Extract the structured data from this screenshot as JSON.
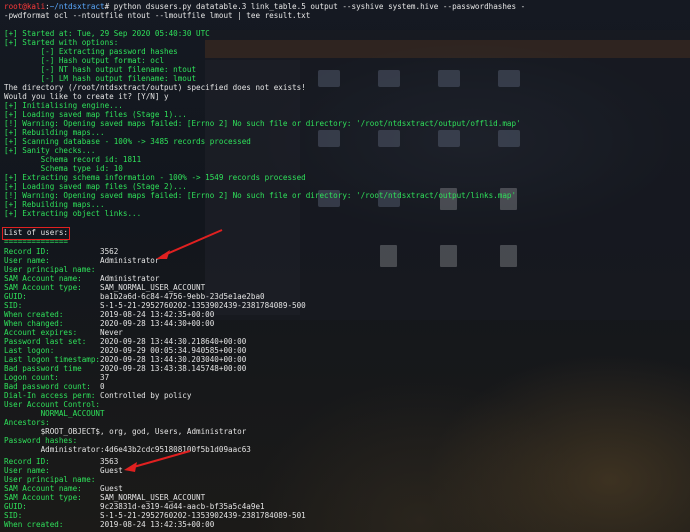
{
  "prompt": {
    "user": "root@kali",
    "path": "~/ntdsxtract",
    "symbol": "#",
    "command_1": " python dsusers.py datatable.3 link_table.5 output --syshive system.hive --passwordhashes -",
    "command_2": "-pwdformat ocl --ntoutfile ntout --lmoutfile lmout | tee result.txt"
  },
  "startup": [
    "[+] Started at: Tue, 29 Sep 2020 05:40:30 UTC",
    "[+] Started with options:",
    "        [-] Extracting password hashes",
    "        [-] Hash output format: ocl",
    "        [-] NT hash output filename: ntout",
    "        [-] LM hash output filename: lmout",
    "The directory (/root/ntdsxtract/output) specified does not exists!",
    "Would you like to create it? [Y/N] y"
  ],
  "progress": [
    "[+] Initialising engine...",
    "[+] Loading saved map files (Stage 1)...",
    "[!] Warning: Opening saved maps failed: [Errno 2] No such file or directory: '/root/ntdsxtract/output/offlid.map'",
    "[+] Rebuilding maps...",
    "[+] Scanning database - 100% -> 3485 records processed",
    "[+] Sanity checks...",
    "        Schema record id: 1811",
    "        Schema type id: 10",
    "[+] Extracting schema information - 100% -> 1549 records processed",
    "[+] Loading saved map files (Stage 2)...",
    "[!] Warning: Opening saved maps failed: [Errno 2] No such file or directory: '/root/ntdsxtract/output/links.map'",
    "[+] Rebuilding maps...",
    "[+] Extracting object links..."
  ],
  "list_header": "List of users:",
  "list_underline": "==============",
  "user_admin": [
    {
      "label": "Record ID:",
      "value": "3562"
    },
    {
      "label": "User name:",
      "value": "Administrator"
    },
    {
      "label": "User principal name:",
      "value": ""
    },
    {
      "label": "SAM Account name:",
      "value": "Administrator"
    },
    {
      "label": "SAM Account type:",
      "value": "SAM_NORMAL_USER_ACCOUNT"
    },
    {
      "label": "GUID:",
      "value": "ba1b2a6d-6c84-4756-9ebb-23d5e1ae2ba0"
    },
    {
      "label": "SID:",
      "value": "S-1-5-21-2952760202-1353902439-2381784089-500"
    },
    {
      "label": "When created:",
      "value": "2019-08-24 13:42:35+00:00"
    },
    {
      "label": "When changed:",
      "value": "2020-09-28 13:44:30+00:00"
    },
    {
      "label": "Account expires:",
      "value": "Never"
    },
    {
      "label": "Password last set:",
      "value": "2020-09-28 13:44:30.218640+00:00"
    },
    {
      "label": "Last logon:",
      "value": "2020-09-29 00:05:34.940585+00:00"
    },
    {
      "label": "Last logon timestamp:",
      "value": "2020-09-28 13:44:30.203040+00:00"
    },
    {
      "label": "Bad password time",
      "value": "2020-09-28 13:43:38.145748+00:00"
    },
    {
      "label": "Logon count:",
      "value": "37"
    },
    {
      "label": "Bad password count:",
      "value": "0"
    },
    {
      "label": "Dial-In access perm:",
      "value": "Controlled by policy"
    }
  ],
  "admin_extra": {
    "uac_label": "User Account Control:",
    "uac_value": "        NORMAL_ACCOUNT",
    "ancestors_label": "Ancestors:",
    "ancestors_value": "        $ROOT_OBJECT$, org, god, Users, Administrator",
    "hashes_label": "Password hashes:",
    "hashes_value": "        Administrator:4d6e43b2cdc951808100f5b1d09aac63"
  },
  "user_guest": [
    {
      "label": "Record ID:",
      "value": "3563"
    },
    {
      "label": "User name:",
      "value": "Guest"
    },
    {
      "label": "User principal name:",
      "value": ""
    },
    {
      "label": "SAM Account name:",
      "value": "Guest"
    },
    {
      "label": "SAM Account type:",
      "value": "SAM_NORMAL_USER_ACCOUNT"
    },
    {
      "label": "GUID:",
      "value": "9c23831d-e319-4d44-aacb-bf35a5c4a9e1"
    },
    {
      "label": "SID:",
      "value": "S-1-5-21-2952760202-1353902439-2381784089-501"
    },
    {
      "label": "When created:",
      "value": "2019-08-24 13:42:35+00:00"
    }
  ],
  "colors": {
    "prompt_user": "#ff3a3a",
    "prompt_path": "#5aa9ff",
    "output": "#2fe05a",
    "highlight": "#e02020"
  }
}
